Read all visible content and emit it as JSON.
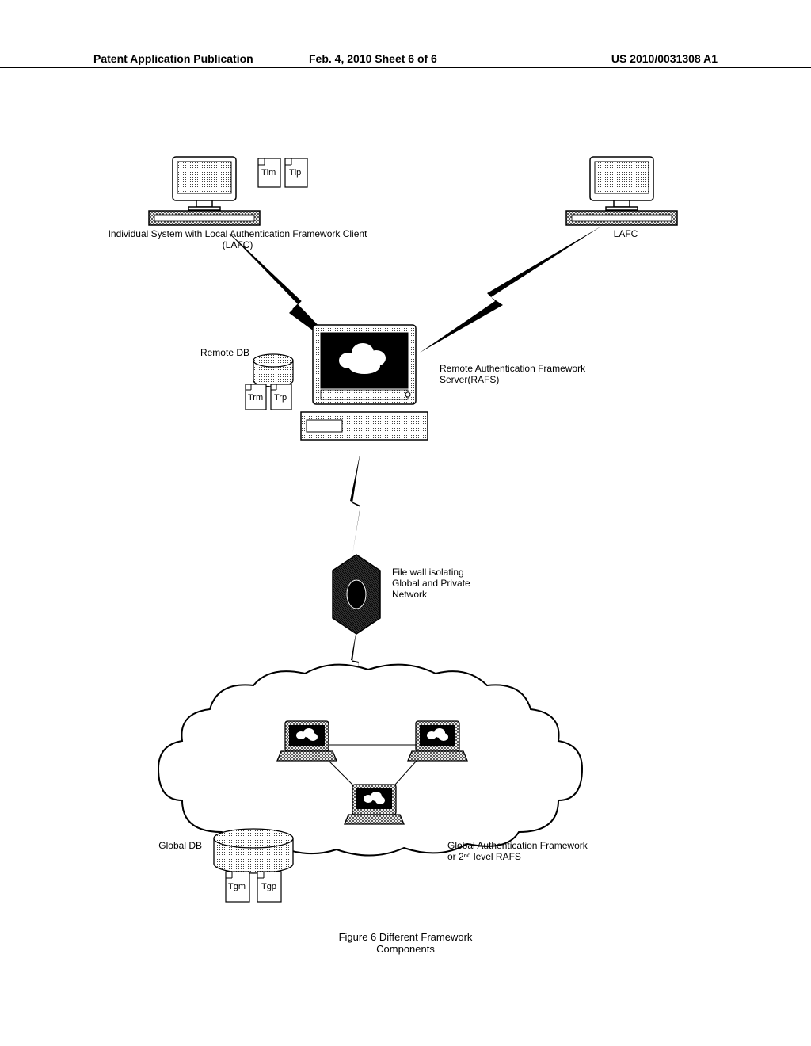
{
  "header": {
    "left": "Patent Application Publication",
    "center": "Feb. 4, 2010  Sheet 6 of 6",
    "right": "US 2010/0031308 A1"
  },
  "labels": {
    "lafc_full": "Individual System with Local Authentication Framework Client\n(LAFC)",
    "lafc_short": "LAFC",
    "tlm": "Tlm",
    "tlp": "Tlp",
    "remote_db": "Remote DB",
    "trm": "Trm",
    "trp": "Trp",
    "rafs": "Remote Authentication Framework\nServer(RAFS)",
    "firewall": "File wall isolating\nGlobal and Private\nNetwork",
    "global_db": "Global DB",
    "tgm": "Tgm",
    "tgp": "Tgp",
    "global_framework": "Global Authentication Framework\nor 2ⁿᵈ level RAFS"
  },
  "caption": "Figure 6 Different Framework\nComponents"
}
